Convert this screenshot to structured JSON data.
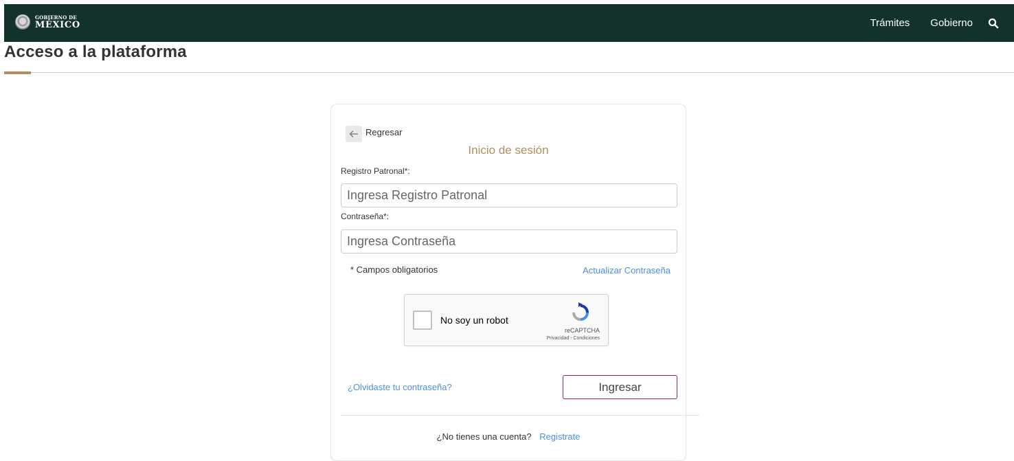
{
  "header": {
    "brand_top": "GOBIERNO DE",
    "brand_main": "MÉXICO",
    "nav": [
      "Trámites",
      "Gobierno"
    ],
    "search_icon": "search-icon",
    "background_color": "#13322b"
  },
  "page": {
    "title": "Acceso a la plataforma",
    "accent_color": "#b38e5d"
  },
  "login": {
    "back_label": "Regresar",
    "title": "Inicio de sesión",
    "registro_label": "Registro Patronal*:",
    "registro_placeholder": "Ingresa Registro Patronal",
    "registro_value": "",
    "password_label": "Contraseña*:",
    "password_placeholder": "Ingresa Contraseña",
    "password_value": "",
    "required_note": "* Campos obligatorios",
    "update_password": "Actualizar Contraseña",
    "forgot_password": "¿Olvidaste tu contraseña?",
    "submit": "Ingresar",
    "no_account": "¿No tienes una cuenta?",
    "register": "Registrate",
    "link_color": "#4a90e2",
    "button_border_color": "#9d2449"
  },
  "captcha": {
    "label": "No soy un robot",
    "brand": "reCAPTCHA",
    "terms": "Privacidad - Condiciones"
  }
}
